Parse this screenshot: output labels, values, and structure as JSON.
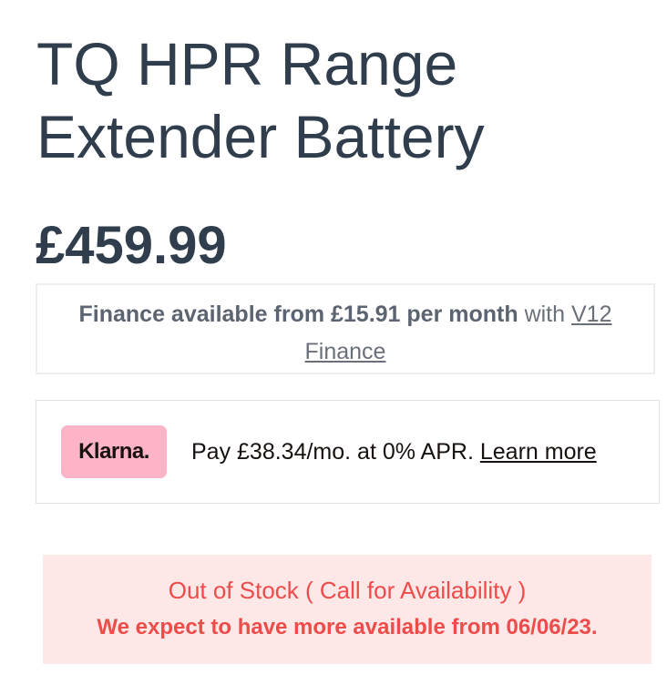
{
  "product": {
    "title": "TQ HPR Range Extender Battery",
    "price": "£459.99"
  },
  "finance": {
    "bold_text": "Finance available from £15.91 per month",
    "with_text": "with",
    "link_text": "V12 Finance"
  },
  "klarna": {
    "logo_text": "Klarna.",
    "message": "Pay £38.34/mo. at 0% APR.",
    "link_text": "Learn more",
    "logo_color": "#ffb3c7"
  },
  "stock": {
    "status": "Out of Stock ( Call for Availability )",
    "expected": "We expect to have more available from 06/06/23.",
    "alert_color": "#ee4b4b",
    "background": "#fde7e7"
  }
}
